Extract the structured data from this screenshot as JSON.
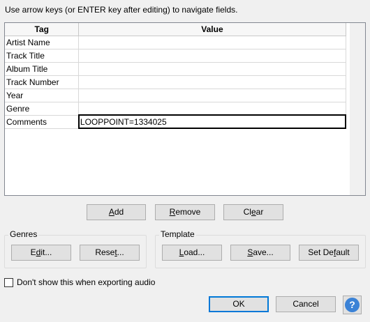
{
  "instruction": "Use arrow keys (or ENTER key after editing) to navigate fields.",
  "table": {
    "headers": {
      "tag": "Tag",
      "value": "Value"
    },
    "rows": [
      {
        "tag": "Artist Name",
        "value": ""
      },
      {
        "tag": "Track Title",
        "value": ""
      },
      {
        "tag": "Album Title",
        "value": ""
      },
      {
        "tag": "Track Number",
        "value": ""
      },
      {
        "tag": "Year",
        "value": ""
      },
      {
        "tag": "Genre",
        "value": ""
      },
      {
        "tag": "Comments",
        "value": "LOOPPOINT=1334025"
      }
    ]
  },
  "actions": {
    "add": {
      "pre": "",
      "key": "A",
      "post": "dd"
    },
    "remove": {
      "pre": "",
      "key": "R",
      "post": "emove"
    },
    "clear": {
      "pre": "Cl",
      "key": "e",
      "post": "ar"
    }
  },
  "genres": {
    "label": "Genres",
    "edit": {
      "pre": "E",
      "key": "d",
      "post": "it..."
    },
    "reset": {
      "pre": "Rese",
      "key": "t",
      "post": "..."
    }
  },
  "template": {
    "label": "Template",
    "load": {
      "pre": "",
      "key": "L",
      "post": "oad..."
    },
    "save": {
      "pre": "",
      "key": "S",
      "post": "ave..."
    },
    "set_default": {
      "pre": "Set De",
      "key": "f",
      "post": "ault"
    }
  },
  "dont_show_label": "Don't show this when exporting audio",
  "dont_show_checked": false,
  "ok_label": "OK",
  "cancel_label": "Cancel",
  "help_icon": "help-icon",
  "help_glyph": "?",
  "accent_color": "#0078d7"
}
